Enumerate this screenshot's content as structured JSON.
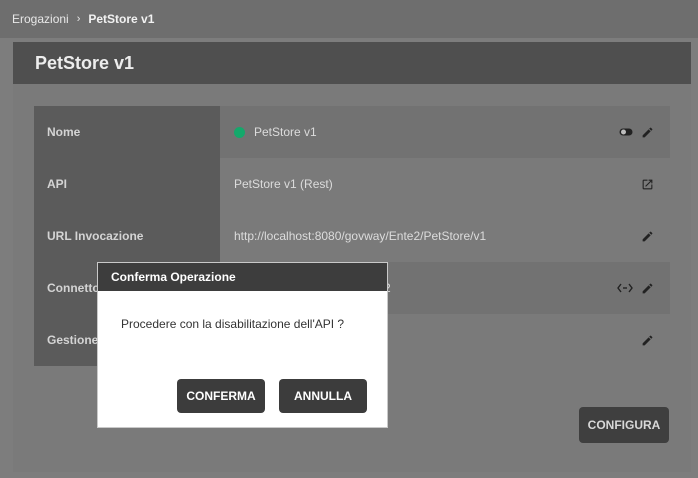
{
  "breadcrumb": {
    "root": "Erogazioni",
    "separator": "›",
    "current": "PetStore v1"
  },
  "page": {
    "title": "PetStore v1"
  },
  "rows": [
    {
      "label": "Nome",
      "value": "PetStore v1"
    },
    {
      "label": "API",
      "value": "PetStore v1 (Rest)"
    },
    {
      "label": "URL Invocazione",
      "value": "http://localhost:8080/govway/Ente2/PetStore/v1"
    },
    {
      "label": "Connettore",
      "value": "2"
    },
    {
      "label": "Gestione",
      "value": ""
    }
  ],
  "status_color": "#14a86b",
  "buttons": {
    "configure": "CONFIGURA"
  },
  "dialog": {
    "title": "Conferma Operazione",
    "message": "Procedere con la disabilitazione dell'API ?",
    "confirm": "CONFERMA",
    "cancel": "ANNULLA"
  }
}
